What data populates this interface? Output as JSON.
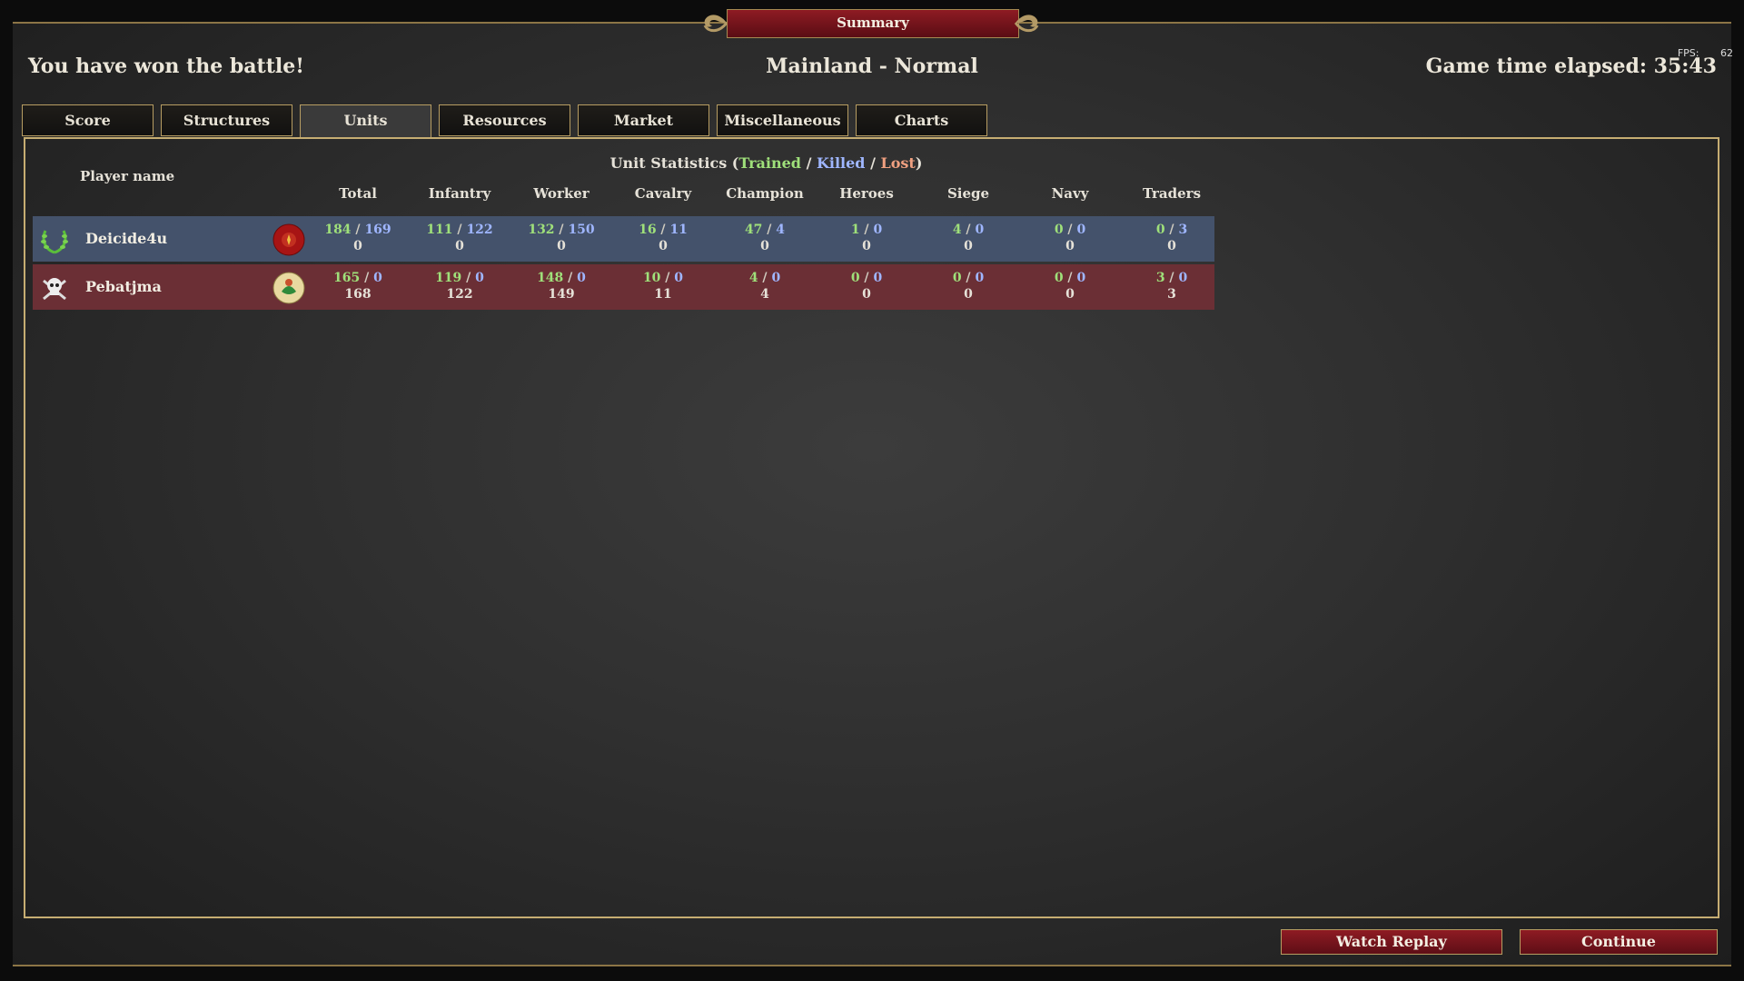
{
  "window": {
    "title": "Summary"
  },
  "header": {
    "victory_text": "You have won the battle!",
    "map_name": "Mainland - Normal",
    "game_time": "Game time elapsed: 35:43",
    "fps_label": "FPS:",
    "fps_value": "62"
  },
  "tabs": [
    {
      "label": "Score"
    },
    {
      "label": "Structures"
    },
    {
      "label": "Units"
    },
    {
      "label": "Resources"
    },
    {
      "label": "Market"
    },
    {
      "label": "Miscellaneous"
    },
    {
      "label": "Charts"
    }
  ],
  "active_tab": "Units",
  "stats": {
    "title_prefix": "Unit Statistics (",
    "trained": "Trained",
    "killed": "Killed",
    "lost": "Lost",
    "slash": " / ",
    "close_paren": ")",
    "player_name_header": "Player name",
    "columns": [
      "Total",
      "Infantry",
      "Worker",
      "Cavalry",
      "Champion",
      "Heroes",
      "Siege",
      "Navy",
      "Traders"
    ],
    "colors": {
      "trained": "#9fe07a",
      "killed": "#9fb6ff",
      "lost": "#f0a080"
    }
  },
  "players": [
    {
      "name": "Deicide4u",
      "status_icon": "laurel-wreath-icon",
      "color": "#44526b",
      "cells": [
        {
          "trained": "184",
          "killed": "169",
          "lost": "0"
        },
        {
          "trained": "111",
          "killed": "122",
          "lost": "0"
        },
        {
          "trained": "132",
          "killed": "150",
          "lost": "0"
        },
        {
          "trained": "16",
          "killed": "11",
          "lost": "0"
        },
        {
          "trained": "47",
          "killed": "4",
          "lost": "0"
        },
        {
          "trained": "1",
          "killed": "0",
          "lost": "0"
        },
        {
          "trained": "4",
          "killed": "0",
          "lost": "0"
        },
        {
          "trained": "0",
          "killed": "0",
          "lost": "0"
        },
        {
          "trained": "0",
          "killed": "3",
          "lost": "0"
        }
      ]
    },
    {
      "name": "Pebatjma",
      "status_icon": "skull-crossbones-icon",
      "color": "#6b2f35",
      "cells": [
        {
          "trained": "165",
          "killed": "0",
          "lost": "168"
        },
        {
          "trained": "119",
          "killed": "0",
          "lost": "122"
        },
        {
          "trained": "148",
          "killed": "0",
          "lost": "149"
        },
        {
          "trained": "10",
          "killed": "0",
          "lost": "11"
        },
        {
          "trained": "4",
          "killed": "0",
          "lost": "4"
        },
        {
          "trained": "0",
          "killed": "0",
          "lost": "0"
        },
        {
          "trained": "0",
          "killed": "0",
          "lost": "0"
        },
        {
          "trained": "0",
          "killed": "0",
          "lost": "0"
        },
        {
          "trained": "3",
          "killed": "0",
          "lost": "3"
        }
      ]
    }
  ],
  "buttons": {
    "watch_replay": "Watch Replay",
    "continue": "Continue"
  }
}
